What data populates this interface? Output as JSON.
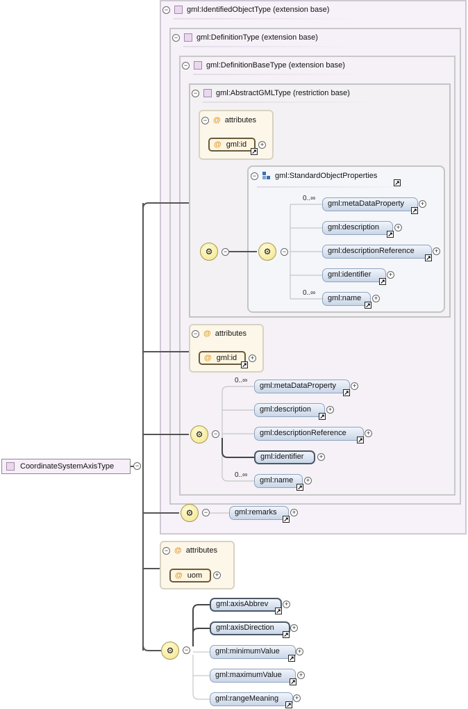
{
  "root": {
    "label": "CoordinateSystemAxisType"
  },
  "extensions": {
    "identified": "gml:IdentifiedObjectType (extension base)",
    "definition": "gml:DefinitionType (extension base)",
    "definition_base": "gml:DefinitionBaseType (extension base)",
    "abstract_gml": "gml:AbstractGMLType (restriction base)"
  },
  "labels": {
    "attributes": "attributes",
    "at": "@",
    "minus": "−",
    "plus": "+",
    "ref": "↗"
  },
  "abstract_attrs": {
    "id": "gml:id"
  },
  "standard_object_properties": {
    "title": "gml:StandardObjectProperties",
    "items": [
      {
        "label": "gml:metaDataProperty",
        "occurs": "0..∞"
      },
      {
        "label": "gml:description",
        "occurs": ""
      },
      {
        "label": "gml:descriptionReference",
        "occurs": ""
      },
      {
        "label": "gml:identifier",
        "occurs": ""
      },
      {
        "label": "gml:name",
        "occurs": "0..∞"
      }
    ]
  },
  "definition_attrs": {
    "id": "gml:id"
  },
  "definition_seq": {
    "items": [
      {
        "label": "gml:metaDataProperty",
        "occurs": "0..∞"
      },
      {
        "label": "gml:description",
        "occurs": ""
      },
      {
        "label": "gml:descriptionReference",
        "occurs": ""
      },
      {
        "label": "gml:identifier",
        "occurs": ""
      },
      {
        "label": "gml:name",
        "occurs": "0..∞"
      }
    ]
  },
  "identified_seq": {
    "items": [
      {
        "label": "gml:remarks"
      }
    ]
  },
  "axis_attrs": {
    "uom": "uom"
  },
  "axis_seq": {
    "items": [
      {
        "label": "gml:axisAbbrev"
      },
      {
        "label": "gml:axisDirection"
      },
      {
        "label": "gml:minimumValue"
      },
      {
        "label": "gml:maximumValue"
      },
      {
        "label": "gml:rangeMeaning"
      }
    ]
  }
}
